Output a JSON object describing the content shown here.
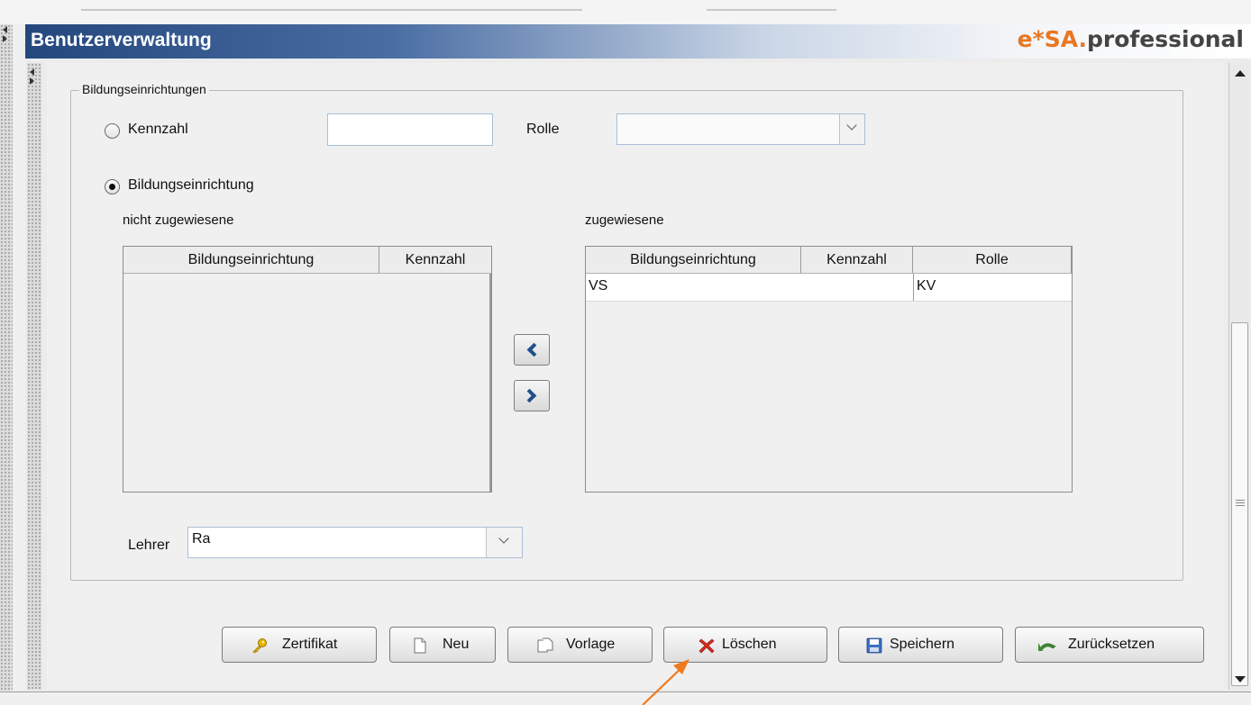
{
  "window": {
    "title": "Benutzerverwaltung",
    "brand_part1": "e*SA.",
    "brand_part2": "professional"
  },
  "group": {
    "legend": "Bildungseinrichtungen",
    "radio_kennzahl": {
      "label": "Kennzahl",
      "selected": false
    },
    "kennzahl_value": "",
    "rolle_label": "Rolle",
    "rolle_value": "",
    "radio_bildung": {
      "label": "Bildungseinrichtung",
      "selected": true
    },
    "left_list": {
      "caption": "nicht zugewiesene",
      "columns": [
        "Bildungseinrichtung",
        "Kennzahl"
      ],
      "rows": []
    },
    "right_list": {
      "caption": "zugewiesene",
      "columns": [
        "Bildungseinrichtung",
        "Kennzahl",
        "Rolle"
      ],
      "rows": [
        {
          "bildungseinrichtung": "VS",
          "kennzahl": "",
          "rolle": "KV"
        }
      ]
    },
    "lehrer_label": "Lehrer",
    "lehrer_value": "Ra"
  },
  "buttons": {
    "zertifikat": "Zertifikat",
    "neu": "Neu",
    "vorlage": "Vorlage",
    "loeschen": "Löschen",
    "speichern": "Speichern",
    "zuruecksetzen": "Zurücksetzen"
  },
  "icons": {
    "zertifikat": "key-icon",
    "neu": "new-document-icon",
    "vorlage": "copy-documents-icon",
    "loeschen": "red-x-delete-icon",
    "speichern": "floppy-disk-icon",
    "zuruecksetzen": "undo-arrow-icon"
  },
  "colors": {
    "title_bar": "#24487e",
    "brand_orange": "#e87722",
    "annotation_arrow": "#f07a1e",
    "arrow_button": "#1f4f8a"
  }
}
